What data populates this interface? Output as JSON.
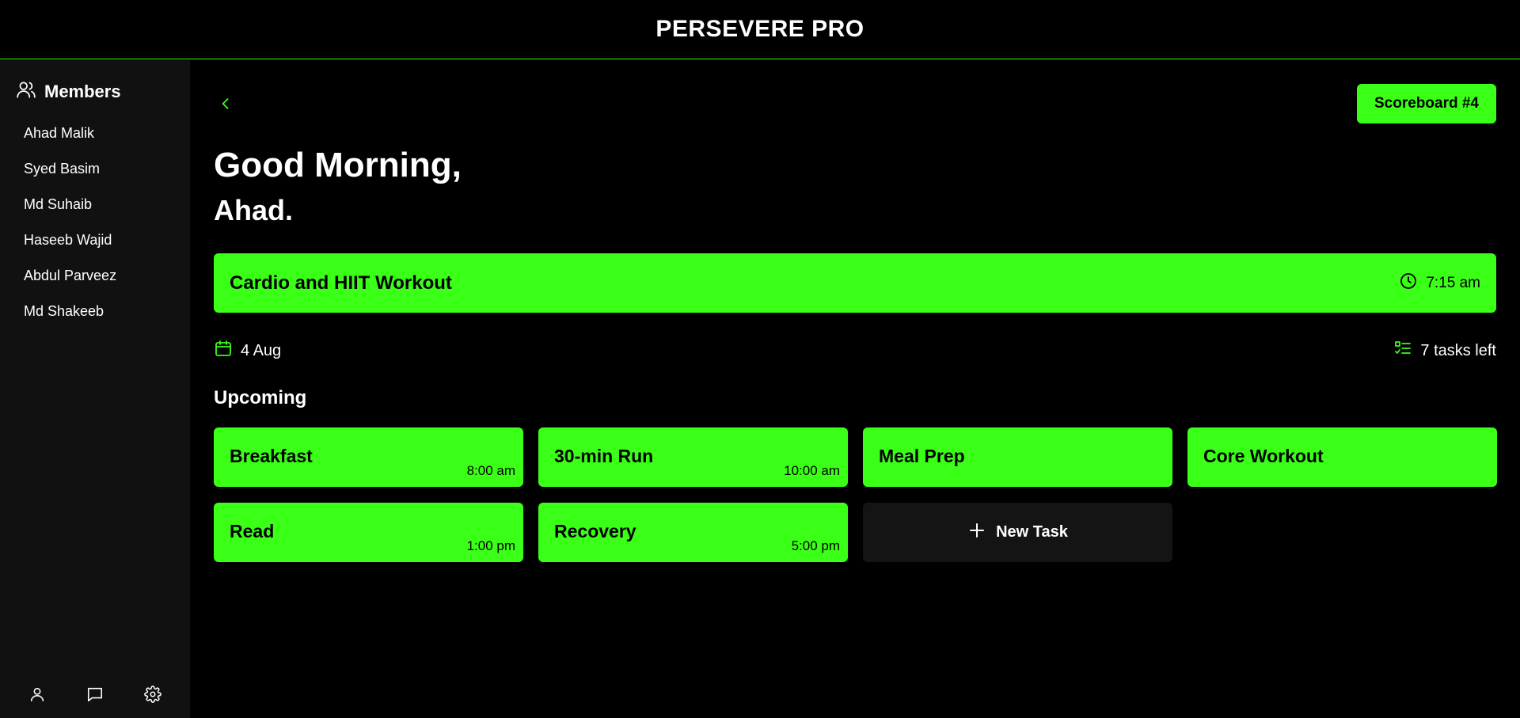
{
  "app": {
    "title": "PERSEVERE PRO"
  },
  "sidebar": {
    "members_title": "Members",
    "members": [
      "Ahad Malik",
      "Syed Basim",
      "Md Suhaib",
      "Haseeb Wajid",
      "Abdul Parveez",
      "Md Shakeeb"
    ],
    "bottom_icons": [
      "user-icon",
      "chat-icon",
      "settings-icon"
    ]
  },
  "main": {
    "scoreboard_label": "Scoreboard #4",
    "greeting": "Good Morning,",
    "name": "Ahad.",
    "current_task": {
      "name": "Cardio and HIIT Workout",
      "time": "7:15 am"
    },
    "date": "4 Aug",
    "tasks_left": "7 tasks left",
    "upcoming_title": "Upcoming",
    "upcoming": [
      {
        "name": "Breakfast",
        "time": "8:00 am"
      },
      {
        "name": "30-min Run",
        "time": "10:00 am"
      },
      {
        "name": "Meal Prep",
        "time": ""
      },
      {
        "name": "Core Workout",
        "time": ""
      },
      {
        "name": "Read",
        "time": "1:00 pm"
      },
      {
        "name": "Recovery",
        "time": "5:00 pm"
      }
    ],
    "new_task_label": "New Task"
  },
  "colors": {
    "accent": "#3aff17",
    "background": "#000000",
    "sidebar": "#111111",
    "card_dark": "#141414"
  }
}
